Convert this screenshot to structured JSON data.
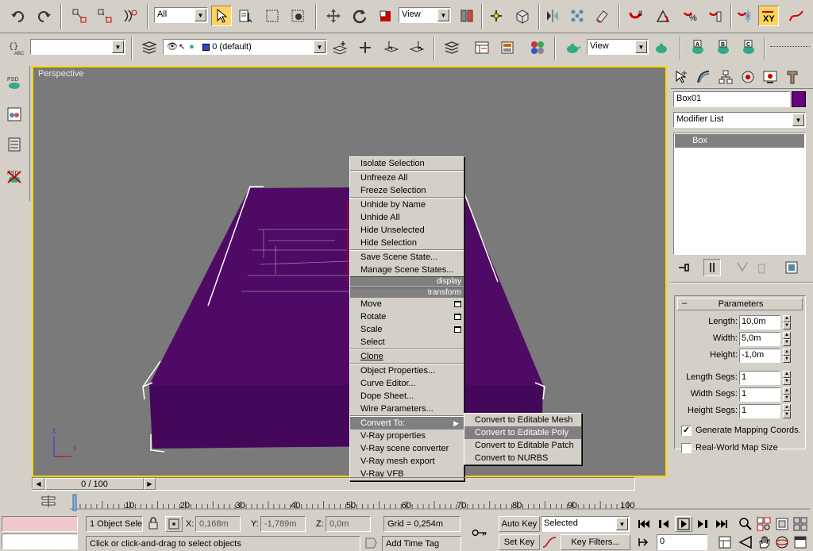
{
  "toolbar": {
    "selection_filter": "All",
    "ref_coord": "View",
    "named_selection": "",
    "layer": "0 (default)",
    "render_view": "View",
    "snap_angle": "3",
    "percent_snap": "%"
  },
  "viewport": {
    "label": "Perspective",
    "axis_z": "z",
    "axis_x": "x"
  },
  "context_menu": {
    "display_items": [
      "Isolate Selection",
      "Unfreeze All",
      "Freeze Selection",
      "Unhide by Name",
      "Unhide All",
      "Hide Unselected",
      "Hide Selection",
      "Save Scene State...",
      "Manage Scene States..."
    ],
    "display_header": "display",
    "transform_header": "transform",
    "transform_items": [
      "Move",
      "Rotate",
      "Scale",
      "Select",
      "Clone",
      "Object Properties...",
      "Curve Editor...",
      "Dope Sheet...",
      "Wire Parameters...",
      "Convert To:",
      "V-Ray properties",
      "V-Ray scene converter",
      "V-Ray mesh export",
      "V-Ray VFB"
    ],
    "submenu": [
      "Convert to Editable Mesh",
      "Convert to Editable Poly",
      "Convert to Editable Patch",
      "Convert to NURBS"
    ],
    "highlighted_item": "Convert To:",
    "highlighted_subitem": "Convert to Editable Poly"
  },
  "command_panel": {
    "object_name": "Box01",
    "object_color": "#6a0080",
    "modifier_list": "Modifier List",
    "stack": [
      "Box"
    ],
    "rollout_title": "Parameters",
    "params": [
      {
        "label": "Length:",
        "value": "10,0m"
      },
      {
        "label": "Width:",
        "value": "5,0m"
      },
      {
        "label": "Height:",
        "value": "-1,0m"
      }
    ],
    "segs": [
      {
        "label": "Length Segs:",
        "value": "1"
      },
      {
        "label": "Width Segs:",
        "value": "1"
      },
      {
        "label": "Height Segs:",
        "value": "1"
      }
    ],
    "gen_mapping": "Generate Mapping Coords.",
    "gen_mapping_checked": true,
    "real_world": "Real-World Map Size",
    "real_world_checked": false
  },
  "timeline": {
    "slider_label": "0 / 100",
    "ticks": [
      "10",
      "20",
      "30",
      "40",
      "50",
      "60",
      "70",
      "80",
      "90",
      "100"
    ]
  },
  "status": {
    "selection": "1 Object Sele",
    "x_label": "X:",
    "x_value": "0,168m",
    "y_label": "Y:",
    "y_value": "-1,789m",
    "z_label": "Z:",
    "z_value": "0,0m",
    "grid": "Grid = 0,254m",
    "prompt": "Click or click-and-drag to select objects",
    "add_time_tag": "Add Time Tag",
    "auto_key": "Auto Key",
    "set_key": "Set Key",
    "key_mode": "Selected",
    "key_filters": "Key Filters...",
    "frame": "0"
  },
  "colors": {
    "box_purple": "#4e0a64",
    "viewport_border": "#ffd800",
    "viewport_bg": "#7a7a7a"
  }
}
